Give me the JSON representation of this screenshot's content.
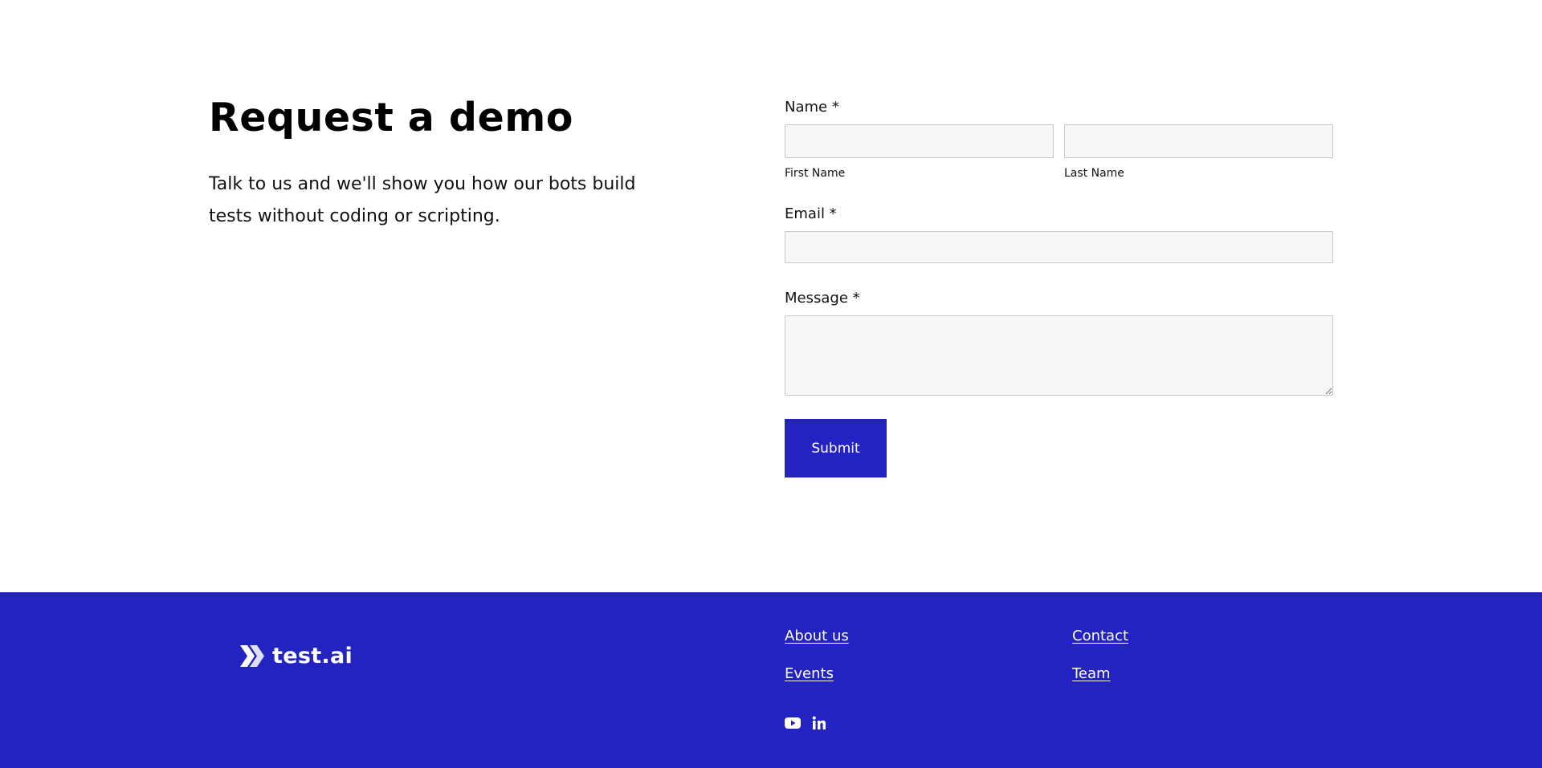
{
  "intro": {
    "title": "Request a demo",
    "description": "Talk to us and we'll show you how our bots build tests without coding or scripting."
  },
  "form": {
    "name_label": "Name *",
    "first_name_label": "First Name",
    "last_name_label": "Last Name",
    "first_name_value": "",
    "last_name_value": "",
    "email_label": "Email *",
    "email_value": "",
    "message_label": "Message *",
    "message_value": "",
    "submit_label": "Submit"
  },
  "footer": {
    "logo_text": "test.ai",
    "links": {
      "about": "About us",
      "contact": "Contact",
      "events": "Events",
      "team": "Team"
    },
    "social": [
      "youtube-icon",
      "linkedin-icon"
    ]
  },
  "colors": {
    "brand": "#2323c1",
    "input_bg": "#f7f7f7",
    "input_border": "#c8c8c8",
    "text": "#111111"
  }
}
